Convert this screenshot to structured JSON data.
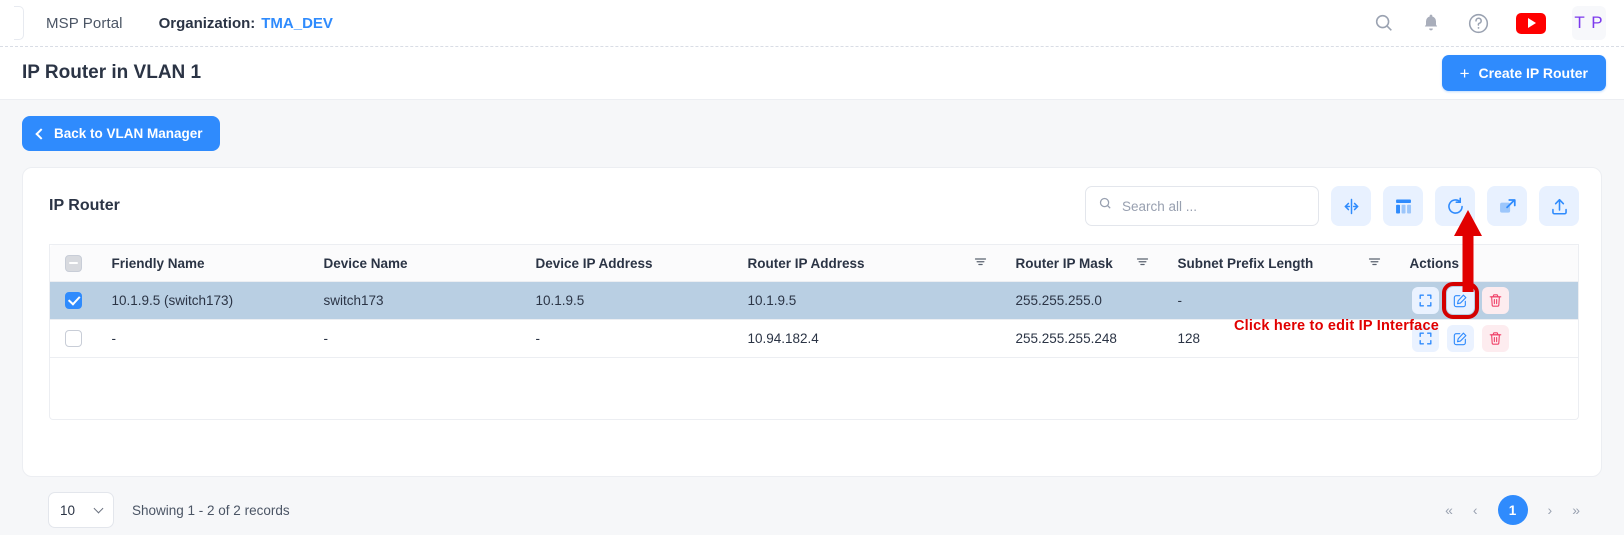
{
  "topbar": {
    "brand": "MSP Portal",
    "org_label": "Organization:",
    "org_value": "TMA_DEV",
    "icons": [
      "search-icon",
      "bell-icon",
      "help-icon",
      "youtube-icon"
    ],
    "avatar_initials": "T P"
  },
  "page": {
    "title": "IP Router in VLAN 1",
    "create_button": "Create IP Router",
    "create_plus": "+",
    "back_button": "Back to VLAN Manager"
  },
  "card": {
    "title": "IP Router",
    "search_placeholder": "Search all ...",
    "search_value": "",
    "tools": [
      "fit-columns-icon",
      "column-settings-icon",
      "refresh-icon",
      "expand-icon",
      "export-icon"
    ]
  },
  "table": {
    "columns": [
      {
        "label": "Friendly Name",
        "filter": false
      },
      {
        "label": "Device Name",
        "filter": false
      },
      {
        "label": "Device IP Address",
        "filter": false
      },
      {
        "label": "Router IP Address",
        "filter": true
      },
      {
        "label": "Router IP Mask",
        "filter": true
      },
      {
        "label": "Subnet Prefix Length",
        "filter": true
      },
      {
        "label": "Actions",
        "filter": false
      }
    ],
    "header_checkbox_state": "indeterminate",
    "rows": [
      {
        "selected": true,
        "friendly_name": "10.1.9.5 (switch173)",
        "device_name": "switch173",
        "device_ip_address": "10.1.9.5",
        "router_ip_address": "10.1.9.5",
        "router_ip_mask": "255.255.255.0",
        "subnet_prefix_length": "-",
        "actions": [
          "fullscreen-icon",
          "edit-icon",
          "delete-icon"
        ]
      },
      {
        "selected": false,
        "friendly_name": "-",
        "device_name": "-",
        "device_ip_address": "-",
        "router_ip_address": "10.94.182.4",
        "router_ip_mask": "255.255.255.248",
        "subnet_prefix_length": "128",
        "actions": [
          "fullscreen-icon",
          "edit-icon",
          "delete-icon"
        ]
      }
    ]
  },
  "annotation": {
    "text": "Click here to edit IP Interface",
    "color": "#e10000"
  },
  "footer": {
    "page_size": "10",
    "showing": "Showing 1 - 2 of 2 records",
    "first": "«",
    "prev": "‹",
    "current_page": "1",
    "next": "›",
    "last": "»"
  },
  "colors": {
    "accent": "#2f8bfd",
    "selected_row": "#b9cfe3",
    "danger": "#e10000",
    "avatar_text": "#7c3aed"
  }
}
